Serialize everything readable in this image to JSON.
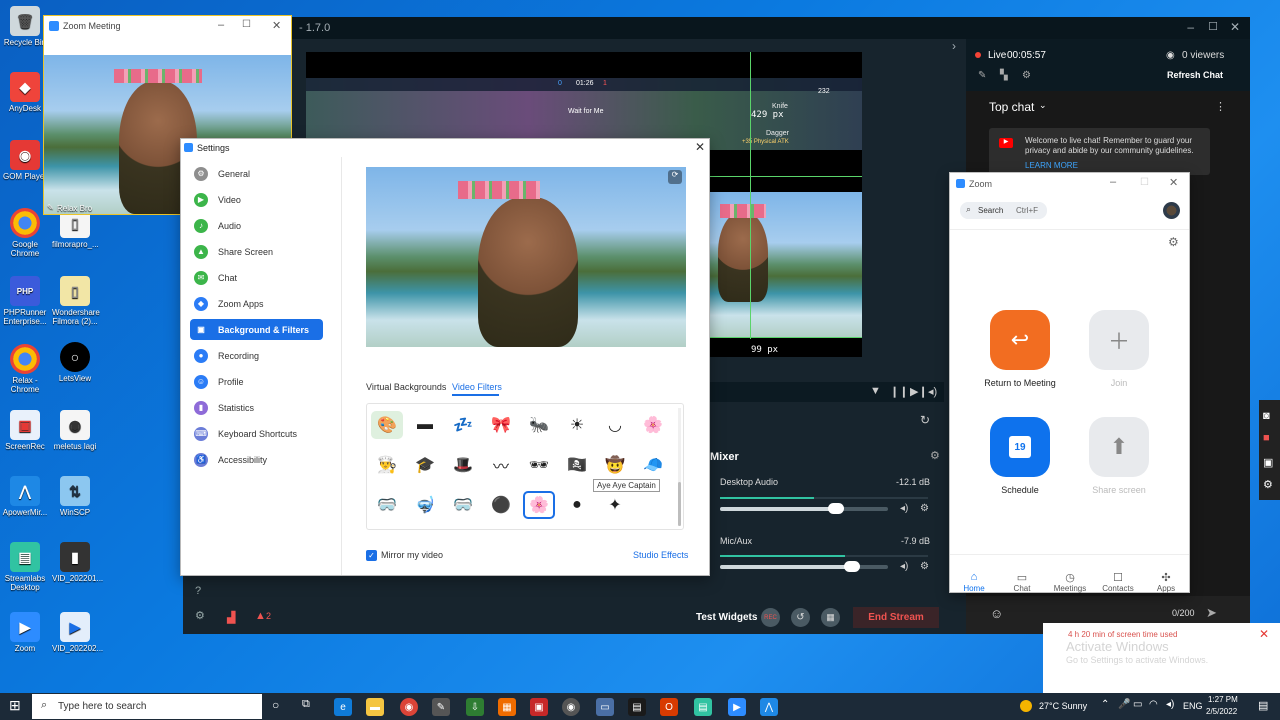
{
  "desktop": {
    "icons_col1": [
      "Recycle Bin",
      "AnyDesk",
      "GOM Player",
      "Google Chrome",
      "PHPRunner Enterprise...",
      "Relax - Chrome",
      "ScreenRec",
      "ApowerMir...",
      "Streamlabs Desktop",
      "Zoom"
    ],
    "icons_col2": [
      "filmorapro_...",
      "Wondershare Filmora (2)...",
      "LetsView",
      "meletus lagi",
      "WinSCP",
      "VID_202201...",
      "VID_202202..."
    ]
  },
  "meeting_window": {
    "title": "Zoom Meeting",
    "participant": "Relax Bro"
  },
  "streamlabs": {
    "version": "- 1.7.0",
    "preview_width_label": "429 px",
    "preview_height_label": "99 px",
    "game_hud": {
      "a": "0",
      "b": "01:26",
      "c": "1",
      "d": "232",
      "wait": "Wait for Me",
      "killer": "Knife",
      "dagger": "Dagger",
      "stat": "+35 Physical ATK"
    },
    "mixer": {
      "title": "Mixer",
      "sources": [
        {
          "name": "Desktop Audio",
          "level": "-12.1 dB",
          "fill": 0.45
        },
        {
          "name": "Mic/Aux",
          "level": "-7.9 dB",
          "fill": 0.6
        }
      ]
    },
    "footer": {
      "alerts": "2",
      "test_widgets": "Test Widgets",
      "rec": "REC",
      "end_stream": "End Stream"
    },
    "chat": {
      "live": "Live",
      "timer": "00:05:57",
      "viewers": "0 viewers",
      "refresh": "Refresh Chat",
      "top_chat": "Top chat",
      "welcome": "Welcome to live chat! Remember to guard your privacy and abide by our community guidelines.",
      "learn_more": "LEARN MORE",
      "counter": "0/200"
    }
  },
  "settings": {
    "title": "Settings",
    "nav": [
      {
        "label": "General",
        "color": "#8e8e8e",
        "glyph": "⚙"
      },
      {
        "label": "Video",
        "color": "#3cb54a",
        "glyph": "▶"
      },
      {
        "label": "Audio",
        "color": "#3cb54a",
        "glyph": "♪"
      },
      {
        "label": "Share Screen",
        "color": "#3cb54a",
        "glyph": "▲"
      },
      {
        "label": "Chat",
        "color": "#3cb54a",
        "glyph": "✉"
      },
      {
        "label": "Zoom Apps",
        "color": "#2b7cf6",
        "glyph": "◆"
      },
      {
        "label": "Background & Filters",
        "color": "#ffffff",
        "glyph": "▣"
      },
      {
        "label": "Recording",
        "color": "#2b7cf6",
        "glyph": "●"
      },
      {
        "label": "Profile",
        "color": "#2b7cf6",
        "glyph": "☺"
      },
      {
        "label": "Statistics",
        "color": "#8e6bd8",
        "glyph": "▮"
      },
      {
        "label": "Keyboard Shortcuts",
        "color": "#6b7dd8",
        "glyph": "⌨"
      },
      {
        "label": "Accessibility",
        "color": "#6b7dd8",
        "glyph": "♿"
      }
    ],
    "tabs": {
      "virtual": "Virtual Backgrounds",
      "filters": "Video Filters"
    },
    "tooltip": "Aye Aye Captain",
    "mirror": "Mirror my video",
    "studio_effects": "Studio Effects",
    "filters": [
      [
        "🎨",
        "▬",
        "💤",
        "🎀",
        "🐜",
        "☀",
        "◡",
        "🌸"
      ],
      [
        "👨‍🍳",
        "🎓",
        "🎩",
        "〰",
        "🕶",
        "🏴‍☠️",
        "🤠",
        "🧢"
      ],
      [
        "🥽",
        "🤿",
        "🥽",
        "⚫",
        "🌸",
        "●",
        "✦"
      ]
    ]
  },
  "zoom_app": {
    "title": "Zoom",
    "search": "Search",
    "shortcut": "Ctrl+F",
    "buttons": [
      "Return to Meeting",
      "Join",
      "Schedule",
      "Share screen"
    ],
    "schedule_day": "19",
    "nav": [
      "Home",
      "Chat",
      "Meetings",
      "Contacts",
      "Apps"
    ]
  },
  "activation": {
    "line1": "Activate Windows",
    "line2": "Go to Settings to activate Windows.",
    "notice": "4 h 20 min of screen time used"
  },
  "taskbar": {
    "search_placeholder": "Type here to search",
    "weather": "27°C  Sunny",
    "lang": "ENG",
    "time": "1:27 PM",
    "date": "2/5/2022"
  }
}
